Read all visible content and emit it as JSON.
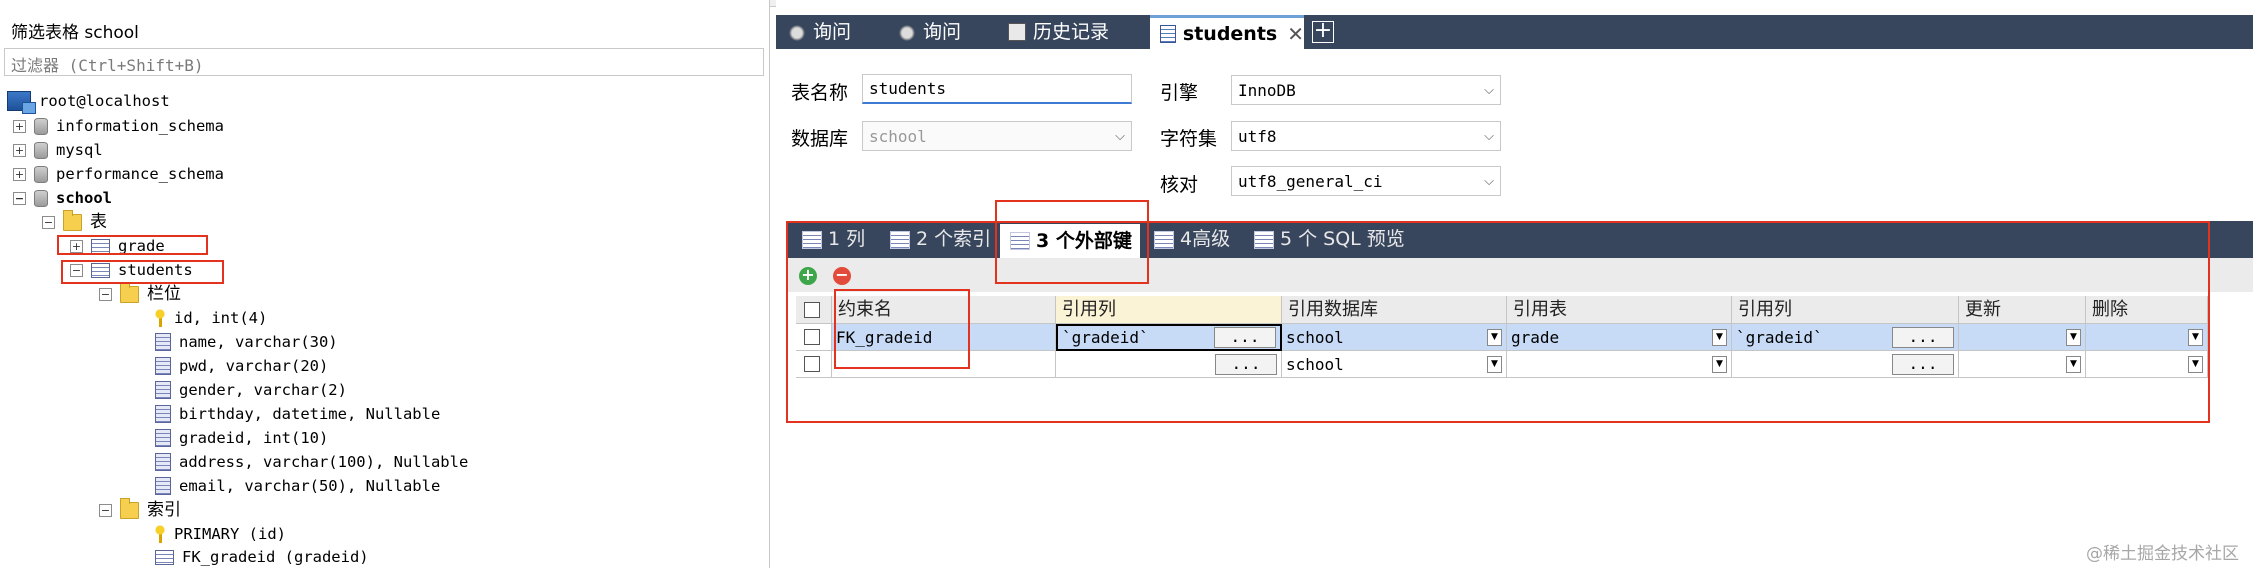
{
  "left_panel": {
    "filter_title": "筛选表格 school",
    "filter_placeholder": "过滤器 (Ctrl+Shift+B)",
    "tree": {
      "root": "root@localhost",
      "databases": [
        "information_schema",
        "mysql",
        "performance_schema",
        "school"
      ],
      "tables_folder": "表",
      "tables": [
        "grade",
        "students"
      ],
      "columns_folder": "栏位",
      "columns": [
        "id, int(4)",
        "name, varchar(30)",
        "pwd, varchar(20)",
        "gender, varchar(2)",
        "birthday, datetime, Nullable",
        "gradeid, int(10)",
        "address, varchar(100), Nullable",
        "email, varchar(50), Nullable"
      ],
      "indexes_folder": "索引",
      "indexes": [
        "PRIMARY (id)",
        "FK_gradeid (gradeid)"
      ]
    }
  },
  "tabs": [
    {
      "label": "询问",
      "icon": "query-icon"
    },
    {
      "label": "询问",
      "icon": "query-icon"
    },
    {
      "label": "历史记录",
      "icon": "history-icon"
    },
    {
      "label": "students",
      "icon": "table-icon",
      "active": true
    }
  ],
  "form": {
    "table_name_label": "表名称",
    "table_name_value": "students",
    "database_label": "数据库",
    "database_value": "school",
    "engine_label": "引擎",
    "engine_value": "InnoDB",
    "charset_label": "字符集",
    "charset_value": "utf8",
    "collation_label": "核对",
    "collation_value": "utf8_general_ci"
  },
  "sub_tabs": [
    "1 列",
    "2 个索引",
    "3 个外部键",
    "4高级",
    "5 个 SQL 预览"
  ],
  "grid": {
    "headers": [
      "约束名",
      "引用列",
      "引用数据库",
      "引用表",
      "引用列",
      "更新",
      "删除"
    ],
    "rows": [
      {
        "name": "FK_gradeid",
        "ref_col": "`gradeid`",
        "ref_db": "school",
        "ref_table": "grade",
        "ref_col2": "`gradeid`",
        "update": "",
        "delete": ""
      },
      {
        "name": "",
        "ref_col": "",
        "ref_db": "school",
        "ref_table": "",
        "ref_col2": "",
        "update": "",
        "delete": ""
      }
    ],
    "dots": "..."
  },
  "watermark": "@稀土掘金技术社区",
  "colors": {
    "accent_red": "#e3321d",
    "tabbar": "#37465d",
    "selection": "#c7daf6"
  }
}
